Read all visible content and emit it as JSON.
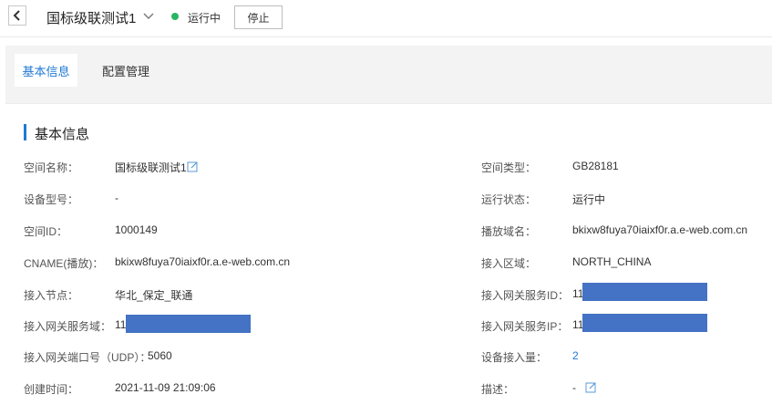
{
  "header": {
    "title": "国标级联测试1",
    "status": "运行中",
    "stop_label": "停止"
  },
  "tabs": [
    {
      "label": "基本信息",
      "active": true
    },
    {
      "label": "配置管理",
      "active": false
    }
  ],
  "section": {
    "title": "基本信息"
  },
  "fields": {
    "space_name": {
      "label": "空间名称：",
      "value": "国标级联测试1"
    },
    "space_type": {
      "label": "空间类型：",
      "value": "GB28181"
    },
    "device_model": {
      "label": "设备型号：",
      "value": "-"
    },
    "run_status": {
      "label": "运行状态：",
      "value": "运行中"
    },
    "space_id": {
      "label": "空间ID：",
      "value": "1000149"
    },
    "play_domain": {
      "label": "播放域名：",
      "value": "bkixw8fuya70iaixf0r.a.e-web.com.cn"
    },
    "cname": {
      "label": "CNAME(播放)：",
      "value": "bkixw8fuya70iaixf0r.a.e-web.com.cn"
    },
    "access_region": {
      "label": "接入区域：",
      "value": "NORTH_CHINA"
    },
    "access_node": {
      "label": "接入节点：",
      "value": "华北_保定_联通"
    },
    "gateway_id": {
      "label": "接入网关服务ID：",
      "value": "11"
    },
    "gateway_domain": {
      "label": "接入网关服务域：",
      "value": "11"
    },
    "gateway_ip": {
      "label": "接入网关服务IP：",
      "value": "11"
    },
    "gateway_port": {
      "label": "接入网关端口号（UDP）：",
      "value": "5060"
    },
    "device_count": {
      "label": "设备接入量：",
      "value": "2"
    },
    "created_at": {
      "label": "创建时间：",
      "value": "2021-11-09 21:09:06"
    },
    "description": {
      "label": "描述：",
      "value": "-"
    }
  },
  "colors": {
    "accent": "#1f79d3",
    "status_green": "#28b463",
    "redaction": "#4472c4"
  },
  "icons": {
    "back": "chevron-left-icon",
    "dropdown": "chevron-down-icon",
    "edit": "edit-icon"
  }
}
